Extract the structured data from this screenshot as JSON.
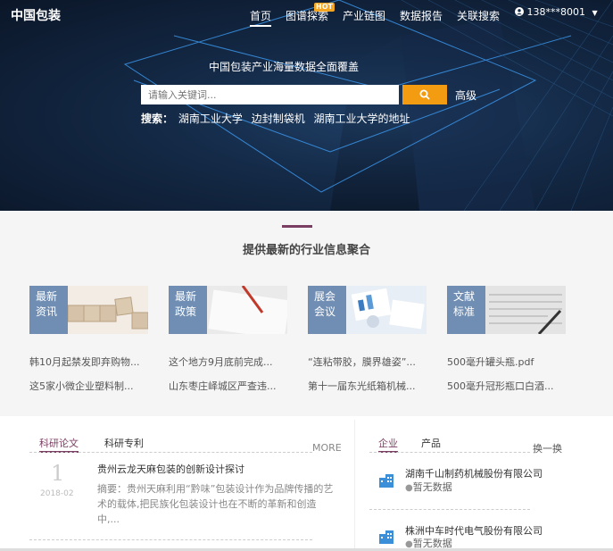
{
  "header": {
    "logo": "中国包装",
    "nav": [
      "首页",
      "图谱探索",
      "产业链图",
      "数据报告",
      "关联搜索"
    ],
    "hot_badge": "HOT",
    "user": "138***8001"
  },
  "hero": {
    "subtitle": "中国包装产业海量数据全面覆盖",
    "search_placeholder": "请输入关键词...",
    "advanced": "高级",
    "hot_label": "搜索：",
    "hot_items": [
      "湖南工业大学",
      "边封制袋机",
      "湖南工业大学的地址"
    ]
  },
  "aggregation": {
    "title": "提供最新的行业信息聚合",
    "cards": [
      {
        "tag1": "最新",
        "tag2": "资讯",
        "links": [
          "韩10月起禁发即弃购物...",
          "这5家小微企业塑料制..."
        ]
      },
      {
        "tag1": "最新",
        "tag2": "政策",
        "links": [
          "这个地方9月底前完成...",
          "山东枣庄峄城区严查违..."
        ]
      },
      {
        "tag1": "展会",
        "tag2": "会议",
        "links": [
          "“连粘带胶，膜界雄姿”...",
          "第十一届东光纸箱机械..."
        ]
      },
      {
        "tag1": "文献",
        "tag2": "标准",
        "links": [
          "500毫升罐头瓶.pdf",
          "500毫升冠形瓶口白酒..."
        ]
      }
    ]
  },
  "research": {
    "tabs": [
      "科研论文",
      "科研专利"
    ],
    "more": "MORE",
    "article": {
      "day": "1",
      "date": "2018-02",
      "title": "贵州云龙天麻包装的创新设计探讨",
      "summary": "摘要：贵州天麻利用“黔味”包装设计作为品牌传播的艺术的载体,把民族化包装设计也在不断的革新和创造中,..."
    }
  },
  "companies": {
    "tabs": [
      "企业",
      "产品"
    ],
    "swap": "换一换",
    "items": [
      {
        "name": "湖南千山制药机械股份有限公司",
        "status": "暂无数据"
      },
      {
        "name": "株洲中车时代电气股份有限公司",
        "status": "暂无数据"
      }
    ]
  },
  "colors": {
    "accent": "#7b3e63",
    "search_button": "#f39c12",
    "card_tag": "#5d7faa"
  }
}
